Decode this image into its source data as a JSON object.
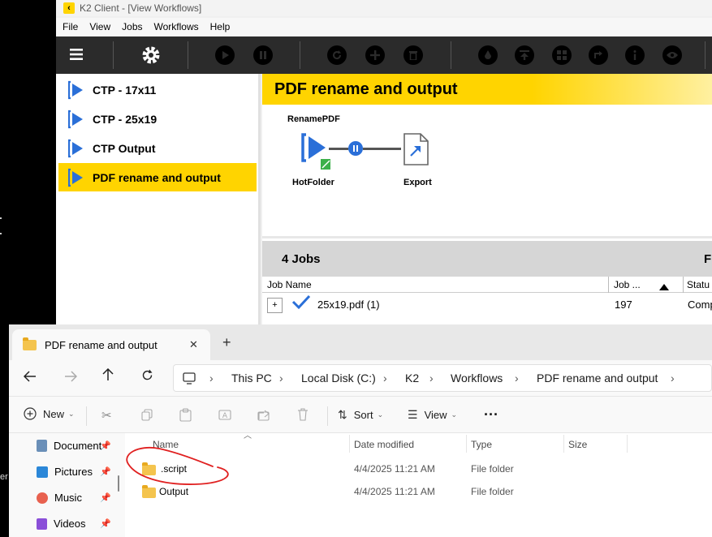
{
  "k2": {
    "title": "K2 Client - [View Workflows]",
    "menu": [
      "File",
      "View",
      "Jobs",
      "Workflows",
      "Help"
    ],
    "toolbar_icons": [
      "menu-icon",
      "settings-gear-icon",
      "play-icon",
      "pause-icon",
      "refresh-icon",
      "add-icon",
      "delete-icon",
      "ink-drop-icon",
      "upload-icon",
      "grid-icon",
      "export-icon",
      "info-icon",
      "eye-icon"
    ],
    "workflows": [
      "CTP - 17x11",
      "CTP - 25x19",
      "CTP Output",
      "PDF rename and output"
    ],
    "selected_workflow": "PDF rename and output",
    "detail_title": "PDF rename and output",
    "flow": {
      "top_label": "RenamePDF",
      "node1_label": "HotFolder",
      "node2_label": "Export"
    },
    "jobs": {
      "count_label": "4 Jobs",
      "right_label": "F",
      "columns": [
        "Job Name",
        "Job ...",
        "Statu"
      ],
      "rows": [
        {
          "expander": "+",
          "name": "25x19.pdf (1)",
          "job": "197",
          "status": "Comp"
        }
      ]
    },
    "accent": "#ffd400"
  },
  "explorer": {
    "tab_title": "PDF rename and output",
    "tab_close": "✕",
    "new_tab": "+",
    "breadcrumb": [
      "This PC",
      "Local Disk (C:)",
      "K2",
      "Workflows",
      "PDF rename and output"
    ],
    "commands": {
      "new": "New",
      "sort": "Sort",
      "view": "View",
      "more": "···"
    },
    "nav_items": [
      "Document",
      "Pictures",
      "Music",
      "Videos"
    ],
    "columns": [
      "Name",
      "Date modified",
      "Type",
      "Size"
    ],
    "files": [
      {
        "name": ".script",
        "date": "4/4/2025 11:21 AM",
        "type": "File folder"
      },
      {
        "name": "Output",
        "date": "4/4/2025 11:21 AM",
        "type": "File folder"
      }
    ],
    "annotation_color": "#e02020"
  },
  "background_fragments": {
    "left_edge_text": "er"
  }
}
